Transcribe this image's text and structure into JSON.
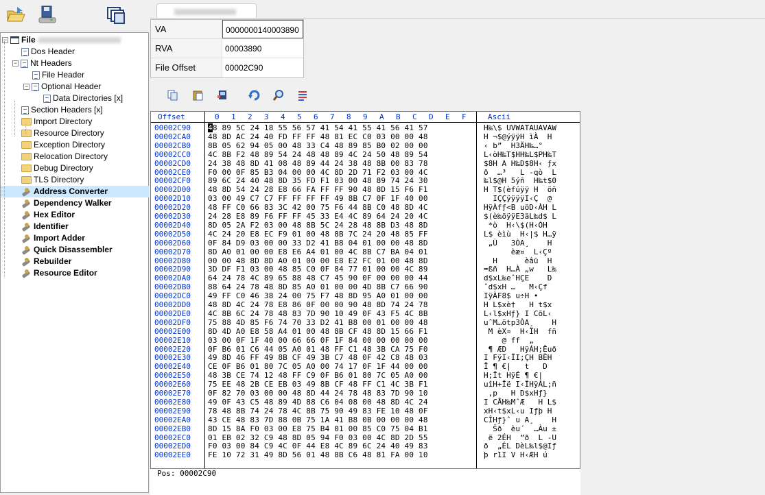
{
  "toolbar": {
    "open_icon": "open-folder-icon",
    "save_icon": "save-disk-icon",
    "windows_icon": "windows-cascade-icon"
  },
  "tab": {
    "title": ""
  },
  "tree": {
    "root": "File",
    "items": [
      {
        "label": "Dos Header",
        "icon": "doc"
      },
      {
        "label": "Nt Headers",
        "icon": "doc"
      },
      {
        "label": "File Header",
        "icon": "doc"
      },
      {
        "label": "Optional Header",
        "icon": "doc"
      },
      {
        "label": "Data Directories [x]",
        "icon": "doc"
      },
      {
        "label": "Section Headers [x]",
        "icon": "doc"
      },
      {
        "label": "Import Directory",
        "icon": "folder"
      },
      {
        "label": "Resource Directory",
        "icon": "folder"
      },
      {
        "label": "Exception Directory",
        "icon": "folder"
      },
      {
        "label": "Relocation Directory",
        "icon": "folder"
      },
      {
        "label": "Debug Directory",
        "icon": "folder"
      },
      {
        "label": "TLS Directory",
        "icon": "folder"
      },
      {
        "label": "Address Converter",
        "icon": "tool"
      },
      {
        "label": "Dependency Walker",
        "icon": "tool"
      },
      {
        "label": "Hex Editor",
        "icon": "tool"
      },
      {
        "label": "Identifier",
        "icon": "tool"
      },
      {
        "label": "Import Adder",
        "icon": "tool"
      },
      {
        "label": "Quick Disassembler",
        "icon": "tool"
      },
      {
        "label": "Rebuilder",
        "icon": "tool"
      },
      {
        "label": "Resource Editor",
        "icon": "tool"
      }
    ],
    "selected": "Address Converter"
  },
  "converter": {
    "va_label": "VA",
    "va_value": "0000000140003890",
    "rva_label": "RVA",
    "rva_value": "00003890",
    "offset_label": "File Offset",
    "offset_value": "00002C90"
  },
  "hex_toolbar": [
    "copy-icon",
    "paste-icon",
    "dump-icon",
    "goto-icon",
    "find-icon",
    "columns-icon"
  ],
  "hex": {
    "offset_header": "Offset",
    "col_headers": [
      "0",
      "1",
      "2",
      "3",
      "4",
      "5",
      "6",
      "7",
      "8",
      "9",
      "A",
      "B",
      "C",
      "D",
      "E",
      "F"
    ],
    "ascii_header": "Ascii",
    "rows": [
      {
        "o": "00002C90",
        "b": "48 89 5C 24 18 55 56 57 41 54 41 55 41 56 41 57",
        "a": "H‰\\$ UVWATAUAVAW"
      },
      {
        "o": "00002CA0",
        "b": "48 8D AC 24 40 FD FF FF 48 81 EC C0 03 00 00 48",
        "a": "H ¬$@ýÿÿH ìÀ  H"
      },
      {
        "o": "00002CB0",
        "b": "8B 05 62 94 05 00 48 33 C4 48 89 85 B0 02 00 00",
        "a": "‹ b”  H3ÄH‰…°   "
      },
      {
        "o": "00002CC0",
        "b": "4C 8B F2 48 89 54 24 48 48 89 4C 24 50 48 89 54",
        "a": "L‹òH‰T$HH‰L$PH‰T"
      },
      {
        "o": "00002CD0",
        "b": "24 38 48 8D 41 08 48 89 44 24 38 48 8B 00 83 78",
        "a": "$8H A H‰D$8H‹ ƒx"
      },
      {
        "o": "00002CE0",
        "b": "F0 00 0F 85 B3 04 00 00 4C 8D 2D 71 F2 03 00 4C",
        "a": "ð  …³   L -qò  L"
      },
      {
        "o": "00002CF0",
        "b": "89 6C 24 40 48 8D 35 FD F1 03 00 48 89 74 24 30",
        "a": "‰l$@H 5ýñ  H‰t$0"
      },
      {
        "o": "00002D00",
        "b": "48 8D 54 24 28 E8 66 FA FF FF 90 48 8D 15 F6 F1",
        "a": "H T$(èfúÿÿ H  öñ"
      },
      {
        "o": "00002D10",
        "b": "03 00 49 C7 C7 FF FF FF FF 49 8B C7 0F 1F 40 00",
        "a": "  IÇÇÿÿÿÿI‹Ç  @ "
      },
      {
        "o": "00002D20",
        "b": "48 FF C0 66 83 3C 42 00 75 F6 44 8B C0 48 8D 4C",
        "a": "HÿÀfƒ<B uöD‹ÀH L"
      },
      {
        "o": "00002D30",
        "b": "24 28 E8 89 F6 FF FF 45 33 E4 4C 89 64 24 20 4C",
        "a": "$(è‰öÿÿE3äL‰d$ L"
      },
      {
        "o": "00002D40",
        "b": "8D 05 2A F2 03 00 48 8B 5C 24 28 48 8B D3 48 8D",
        "a": " *ò  H‹\\$(H‹ÓH "
      },
      {
        "o": "00002D50",
        "b": "4C 24 20 E8 EC F9 01 00 48 8B 7C 24 20 48 85 FF",
        "a": "L$ èìù  H‹|$ H…ÿ"
      },
      {
        "o": "00002D60",
        "b": "0F 84 D9 03 00 00 33 D2 41 B8 04 01 00 00 48 8D",
        "a": " „Ù   3ÒA¸    H "
      },
      {
        "o": "00002D70",
        "b": "8D A0 01 00 00 E8 E6 A4 01 00 4C 8B C7 BA 04 01",
        "a": "      èæ¤  L‹Çº  "
      },
      {
        "o": "00002D80",
        "b": "00 00 48 8D 8D A0 01 00 00 E8 E2 FC 01 00 48 8D",
        "a": "  H      èâü  H "
      },
      {
        "o": "00002D90",
        "b": "3D DF F1 03 00 48 85 C0 0F 84 77 01 00 00 4C 89",
        "a": "=ßñ  H…À „w   L‰"
      },
      {
        "o": "00002DA0",
        "b": "64 24 78 4C 89 65 88 48 C7 45 90 0F 00 00 00 44",
        "a": "d$xL‰eˆHÇE    D"
      },
      {
        "o": "00002DB0",
        "b": "88 64 24 78 48 8D 85 A0 01 00 00 4D 8B C7 66 90",
        "a": "ˆd$xH …   M‹Çf "
      },
      {
        "o": "00002DC0",
        "b": "49 FF C0 46 38 24 00 75 F7 48 8D 95 A0 01 00 00",
        "a": "IÿÀF8$ u÷H •    "
      },
      {
        "o": "00002DD0",
        "b": "48 8D 4C 24 78 E8 86 0F 00 00 90 48 8D 74 24 78",
        "a": "H L$xè†   H t$x"
      },
      {
        "o": "00002DE0",
        "b": "4C 8B 6C 24 78 48 83 7D 90 10 49 0F 43 F5 4C 8B",
        "a": "L‹l$xHƒ} I CõL‹"
      },
      {
        "o": "00002DF0",
        "b": "75 88 4D 85 F6 74 70 33 D2 41 B8 00 01 00 00 48",
        "a": "uˆM…ötp3ÒA¸    H"
      },
      {
        "o": "00002E00",
        "b": "8D 4D A0 E8 58 A4 01 00 48 8B CF 48 8D 15 66 F1",
        "a": " M èX¤  H‹ÏH  fñ"
      },
      {
        "o": "00002E10",
        "b": "03 00 0F 1F 40 00 66 66 0F 1F 84 00 00 00 00 00",
        "a": "    @ ff  „     "
      },
      {
        "o": "00002E20",
        "b": "0F B6 01 C6 44 05 A0 01 48 FF C1 48 3B CA 75 F0",
        "a": " ¶ ÆD   HÿÁH;Êuð"
      },
      {
        "o": "00002E30",
        "b": "49 8D 46 FF 49 8B CF 49 3B C7 48 0F 42 C8 48 03",
        "a": "I FÿI‹ÏI;ÇH BÈH "
      },
      {
        "o": "00002E40",
        "b": "CE 0F B6 01 80 7C 05 A0 00 74 17 0F 1F 44 00 00",
        "a": "Î ¶ €|   t   D  "
      },
      {
        "o": "00002E50",
        "b": "48 3B CE 74 12 48 FF C9 0F B6 01 80 7C 05 A0 00",
        "a": "H;Ît HÿÉ ¶ €|   "
      },
      {
        "o": "00002E60",
        "b": "75 EE 48 2B CE EB 03 49 8B CF 48 FF C1 4C 3B F1",
        "a": "uîH+Îë I‹ÏHÿÁL;ñ"
      },
      {
        "o": "00002E70",
        "b": "0F 82 70 03 00 00 48 8D 44 24 78 48 83 7D 90 10",
        "a": " ‚p   H D$xHƒ}  "
      },
      {
        "o": "00002E80",
        "b": "49 0F 43 C5 48 89 4D 88 C6 04 08 00 48 8D 4C 24",
        "a": "I CÅH‰MˆÆ   H L$"
      },
      {
        "o": "00002E90",
        "b": "78 48 8B 74 24 78 4C 8B 75 90 49 83 FE 10 48 0F",
        "a": "xH‹t$xL‹u Iƒþ H "
      },
      {
        "o": "00002EA0",
        "b": "43 CE 48 83 7D 88 0B 75 1A 41 B8 0B 00 00 00 48",
        "a": "CÎHƒ}ˆ u A¸    H"
      },
      {
        "o": "00002EB0",
        "b": "8D 15 8A F0 03 00 E8 75 B4 01 00 85 C0 75 04 B1",
        "a": "  Šð  èu´  …Àu ±"
      },
      {
        "o": "00002EC0",
        "b": "01 EB 02 32 C9 48 8D 05 94 F0 03 00 4C 8D 2D 55",
        "a": " ë 2ÉH  ”ð  L -U"
      },
      {
        "o": "00002ED0",
        "b": "F0 03 00 84 C9 4C 0F 44 E8 4C 89 6C 24 40 49 83",
        "a": "ð  „ÉL DèL‰l$@Iƒ"
      },
      {
        "o": "00002EE0",
        "b": "FE 10 72 31 49 8D 56 01 48 8B C6 48 81 FA 00 10",
        "a": "þ r1I V H‹ÆH ú  "
      }
    ],
    "pos_label": "Pos:",
    "pos_value": "00002C90"
  }
}
